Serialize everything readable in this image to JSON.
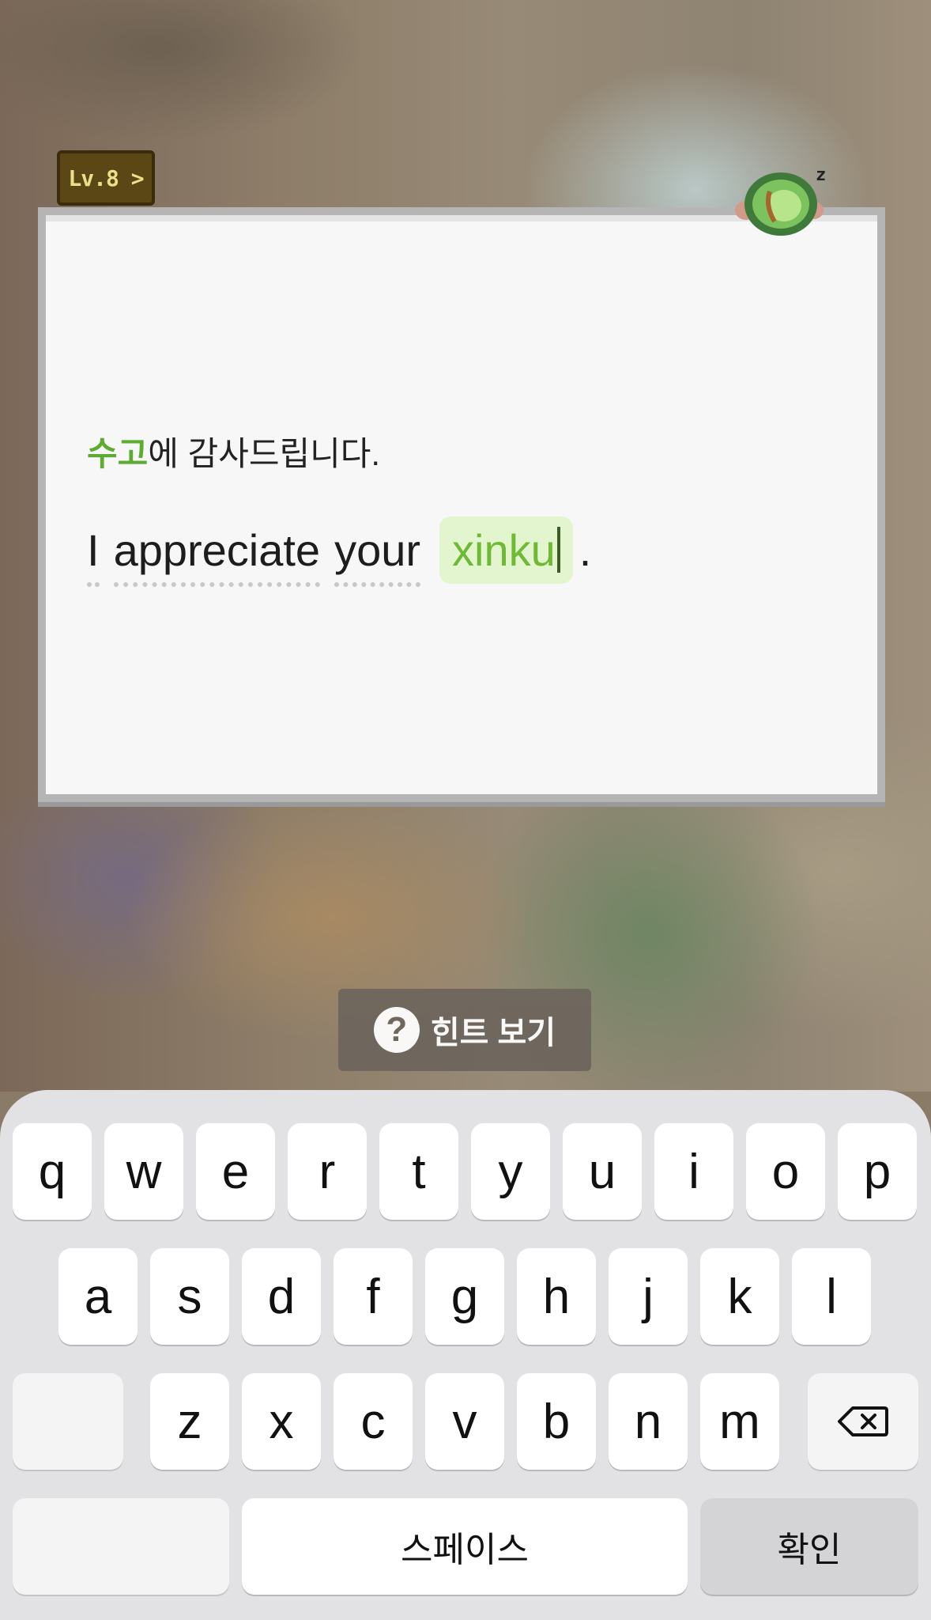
{
  "level_badge": {
    "label": "Lv.8 >"
  },
  "card": {
    "korean_highlight": "수고",
    "korean_rest": "에 감사드립니다.",
    "sentence_words": [
      "I",
      "appreciate",
      "your"
    ],
    "answer_text": "xinku",
    "sentence_end": "."
  },
  "hint": {
    "icon": "?",
    "label": "힌트 보기"
  },
  "keyboard": {
    "row1": [
      "q",
      "w",
      "e",
      "r",
      "t",
      "y",
      "u",
      "i",
      "o",
      "p"
    ],
    "row2": [
      "a",
      "s",
      "d",
      "f",
      "g",
      "h",
      "j",
      "k",
      "l"
    ],
    "row3": [
      "z",
      "x",
      "c",
      "v",
      "b",
      "n",
      "m"
    ],
    "space_label": "스페이스",
    "confirm_label": "확인"
  },
  "colors": {
    "answer_text": "#6fba34",
    "answer_bg": "#e3f5cf",
    "highlight": "#5eab32"
  }
}
